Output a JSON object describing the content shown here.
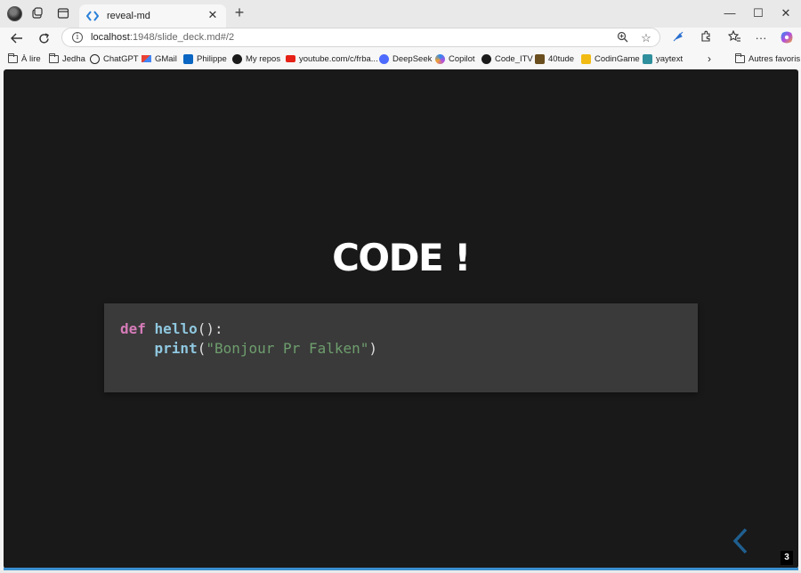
{
  "tab": {
    "title": "reveal-md"
  },
  "address": {
    "host": "localhost",
    "rest": ":1948/slide_deck.md#/2"
  },
  "bookmarks": [
    {
      "label": "À lire",
      "icon": "folder-icon"
    },
    {
      "label": "Jedha",
      "icon": "folder-icon"
    },
    {
      "label": "ChatGPT",
      "icon": "chatgpt-icon"
    },
    {
      "label": "GMail",
      "icon": "gmail-icon"
    },
    {
      "label": "Philippe",
      "icon": "linkedin-icon"
    },
    {
      "label": "My repos",
      "icon": "github-icon"
    },
    {
      "label": "youtube.com/c/frba...",
      "icon": "youtube-icon"
    },
    {
      "label": "DeepSeek",
      "icon": "deepseek-icon"
    },
    {
      "label": "Copilot",
      "icon": "copilot-icon"
    },
    {
      "label": "Code_ITV",
      "icon": "github-icon"
    },
    {
      "label": "40tude",
      "icon": "site-icon"
    },
    {
      "label": "CodinGame",
      "icon": "codingame-icon"
    },
    {
      "label": "yaytext",
      "icon": "yaytext-icon"
    }
  ],
  "other_bookmarks": "Autres favoris",
  "slide": {
    "title": "CODE !",
    "code": {
      "l1_kw": "def",
      "l1_fn": "hello",
      "l1_rest": "():",
      "l2_indent": "    ",
      "l2_fn": "print",
      "l2_open": "(",
      "l2_str": "\"Bonjour Pr Falken\"",
      "l2_close": ")"
    },
    "number": "3"
  },
  "colors": {
    "slide_bg": "#191919",
    "code_bg": "#3a3a3a",
    "keyword": "#d57bb8",
    "function": "#8fc8e0",
    "string": "#6e9e6e",
    "accent": "#3a8fd0"
  }
}
